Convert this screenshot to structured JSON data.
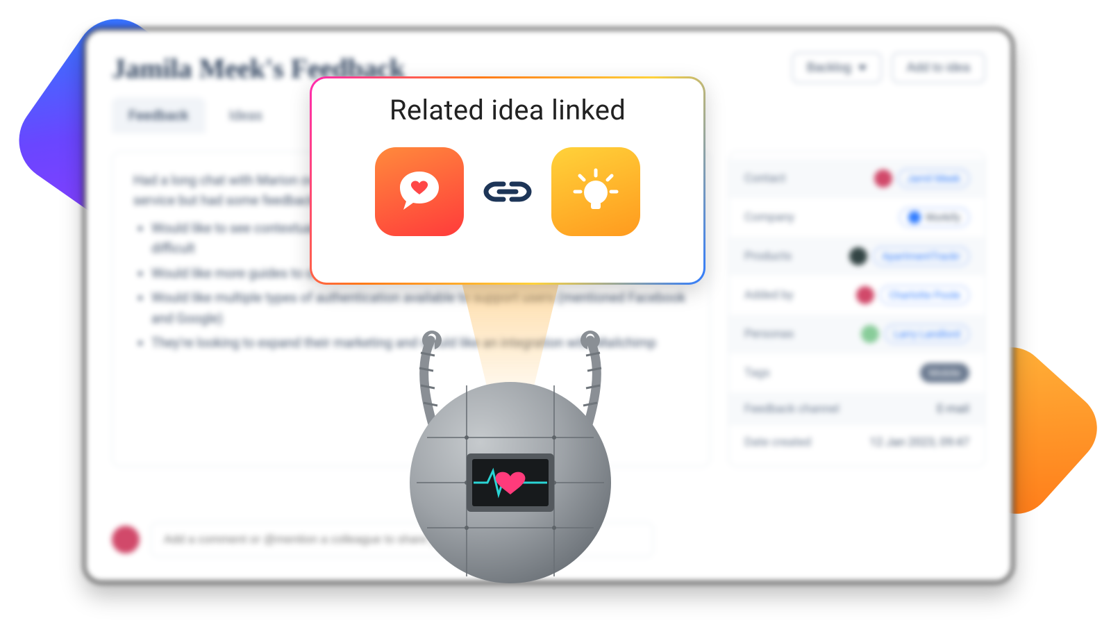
{
  "header": {
    "title": "Jamila Meek's Feedback",
    "backlog_label": "Backlog",
    "add_to_idea_label": "Add to idea"
  },
  "tabs": {
    "feedback": "Feedback",
    "ideas": "Ideas"
  },
  "feedback": {
    "intro": "Had a long chat with Marion over the phone about their experience. Overall they love the service but had some feedback:",
    "bullets": [
      "Would like to see contextual help in the dashboard as they find the context switching is a bit difficult",
      "Would like more guides to onboard new users",
      "Would like multiple types of authentication available to support users (mentioned Facebook and Google)",
      "They're looking to expand their marketing and would like an integration with Mailchimp"
    ]
  },
  "comment": {
    "placeholder": "Add a comment or @mention a colleague to share your thoughts"
  },
  "meta": {
    "contact_label": "Contact",
    "contact": "Jamil Meek",
    "company_label": "Company",
    "company": "Workify",
    "products_label": "Products",
    "product": "ApartmentTrackr",
    "added_by_label": "Added by",
    "added_by": "Charlotte Poole",
    "personas_label": "Personas",
    "persona": "Larry Landlord",
    "tags_label": "Tags",
    "tag": "Mobile",
    "channel_label": "Feedback channel",
    "channel": "E-mail",
    "date_label": "Date created",
    "date": "12 Jan 2023, 09:47"
  },
  "toast": {
    "title": "Related idea linked"
  },
  "icons": {
    "speech_heart": "speech-heart-icon",
    "lightbulb": "lightbulb-icon",
    "chain": "chain-link-icon",
    "caret": "caret-down-icon",
    "robot": "robot-icon"
  }
}
